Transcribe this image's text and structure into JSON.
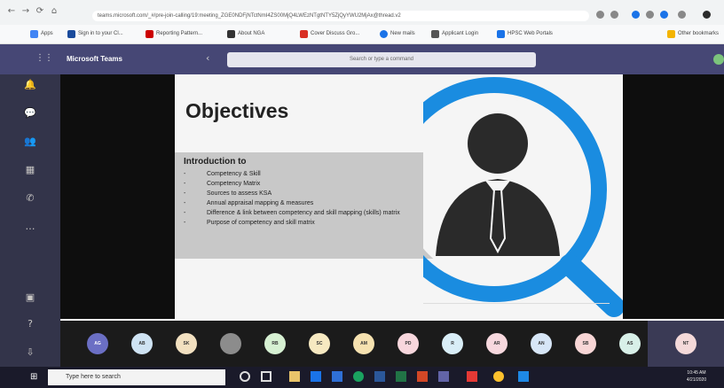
{
  "browser": {
    "address": "teams.microsoft.com/_#/pre-join-calling/19:meeting_ZGE0NDFjNTctNmI4ZS00MjQ4LWEzNTgtNTY5ZjQyYWU2MjAx@thread.v2",
    "bookmarks": [
      "Apps",
      "Sign in to your Cl...",
      "Reporting Pattern...",
      "About NGA",
      "Cover Discuss Gro...",
      "New mails",
      "Applicant Login",
      "HPSC Web Portals",
      "Other bookmarks"
    ]
  },
  "teams": {
    "title": "Microsoft Teams",
    "search_placeholder": "Search or type a command",
    "rail": [
      "Activity",
      "Chat",
      "Teams",
      "Calendar",
      "Calls",
      "Files",
      "Apps",
      "Help"
    ]
  },
  "slide": {
    "title": "Objectives",
    "section": "Introduction to",
    "bullets": [
      "Competency & Skill",
      "Competency Matrix",
      "Sources to assess KSA",
      "Annual appraisal mapping & measures",
      "Difference & link between competency and skill mapping (skills) matrix",
      "Purpose of competency and skill matrix"
    ]
  },
  "participants": [
    {
      "initials": "AG",
      "color": "#6b6fc4"
    },
    {
      "initials": "AB",
      "color": "#cfe3f3"
    },
    {
      "initials": "SK",
      "color": "#f2e0c0"
    },
    {
      "initials": "",
      "color": "#8c8c8c"
    },
    {
      "initials": "RB",
      "color": "#d6f0d2"
    },
    {
      "initials": "SC",
      "color": "#f7e9c1"
    },
    {
      "initials": "AM",
      "color": "#f6e2b0"
    },
    {
      "initials": "PD",
      "color": "#f8d7dd"
    },
    {
      "initials": "R",
      "color": "#d9eef7"
    },
    {
      "initials": "AR",
      "color": "#f7d8de"
    },
    {
      "initials": "AN",
      "color": "#d7e6f7"
    },
    {
      "initials": "SB",
      "color": "#f8d6d6"
    },
    {
      "initials": "AS",
      "color": "#d8f0e8"
    }
  ],
  "self": {
    "initials": "NT",
    "color": "#f4d9d9"
  },
  "taskbar": {
    "search_placeholder": "Type here to search",
    "time": "10:45 AM",
    "date": "4/21/2020"
  },
  "colors": {
    "teams_purple": "#464775",
    "rail": "#33344a",
    "accent_blue": "#1a8ce0"
  }
}
